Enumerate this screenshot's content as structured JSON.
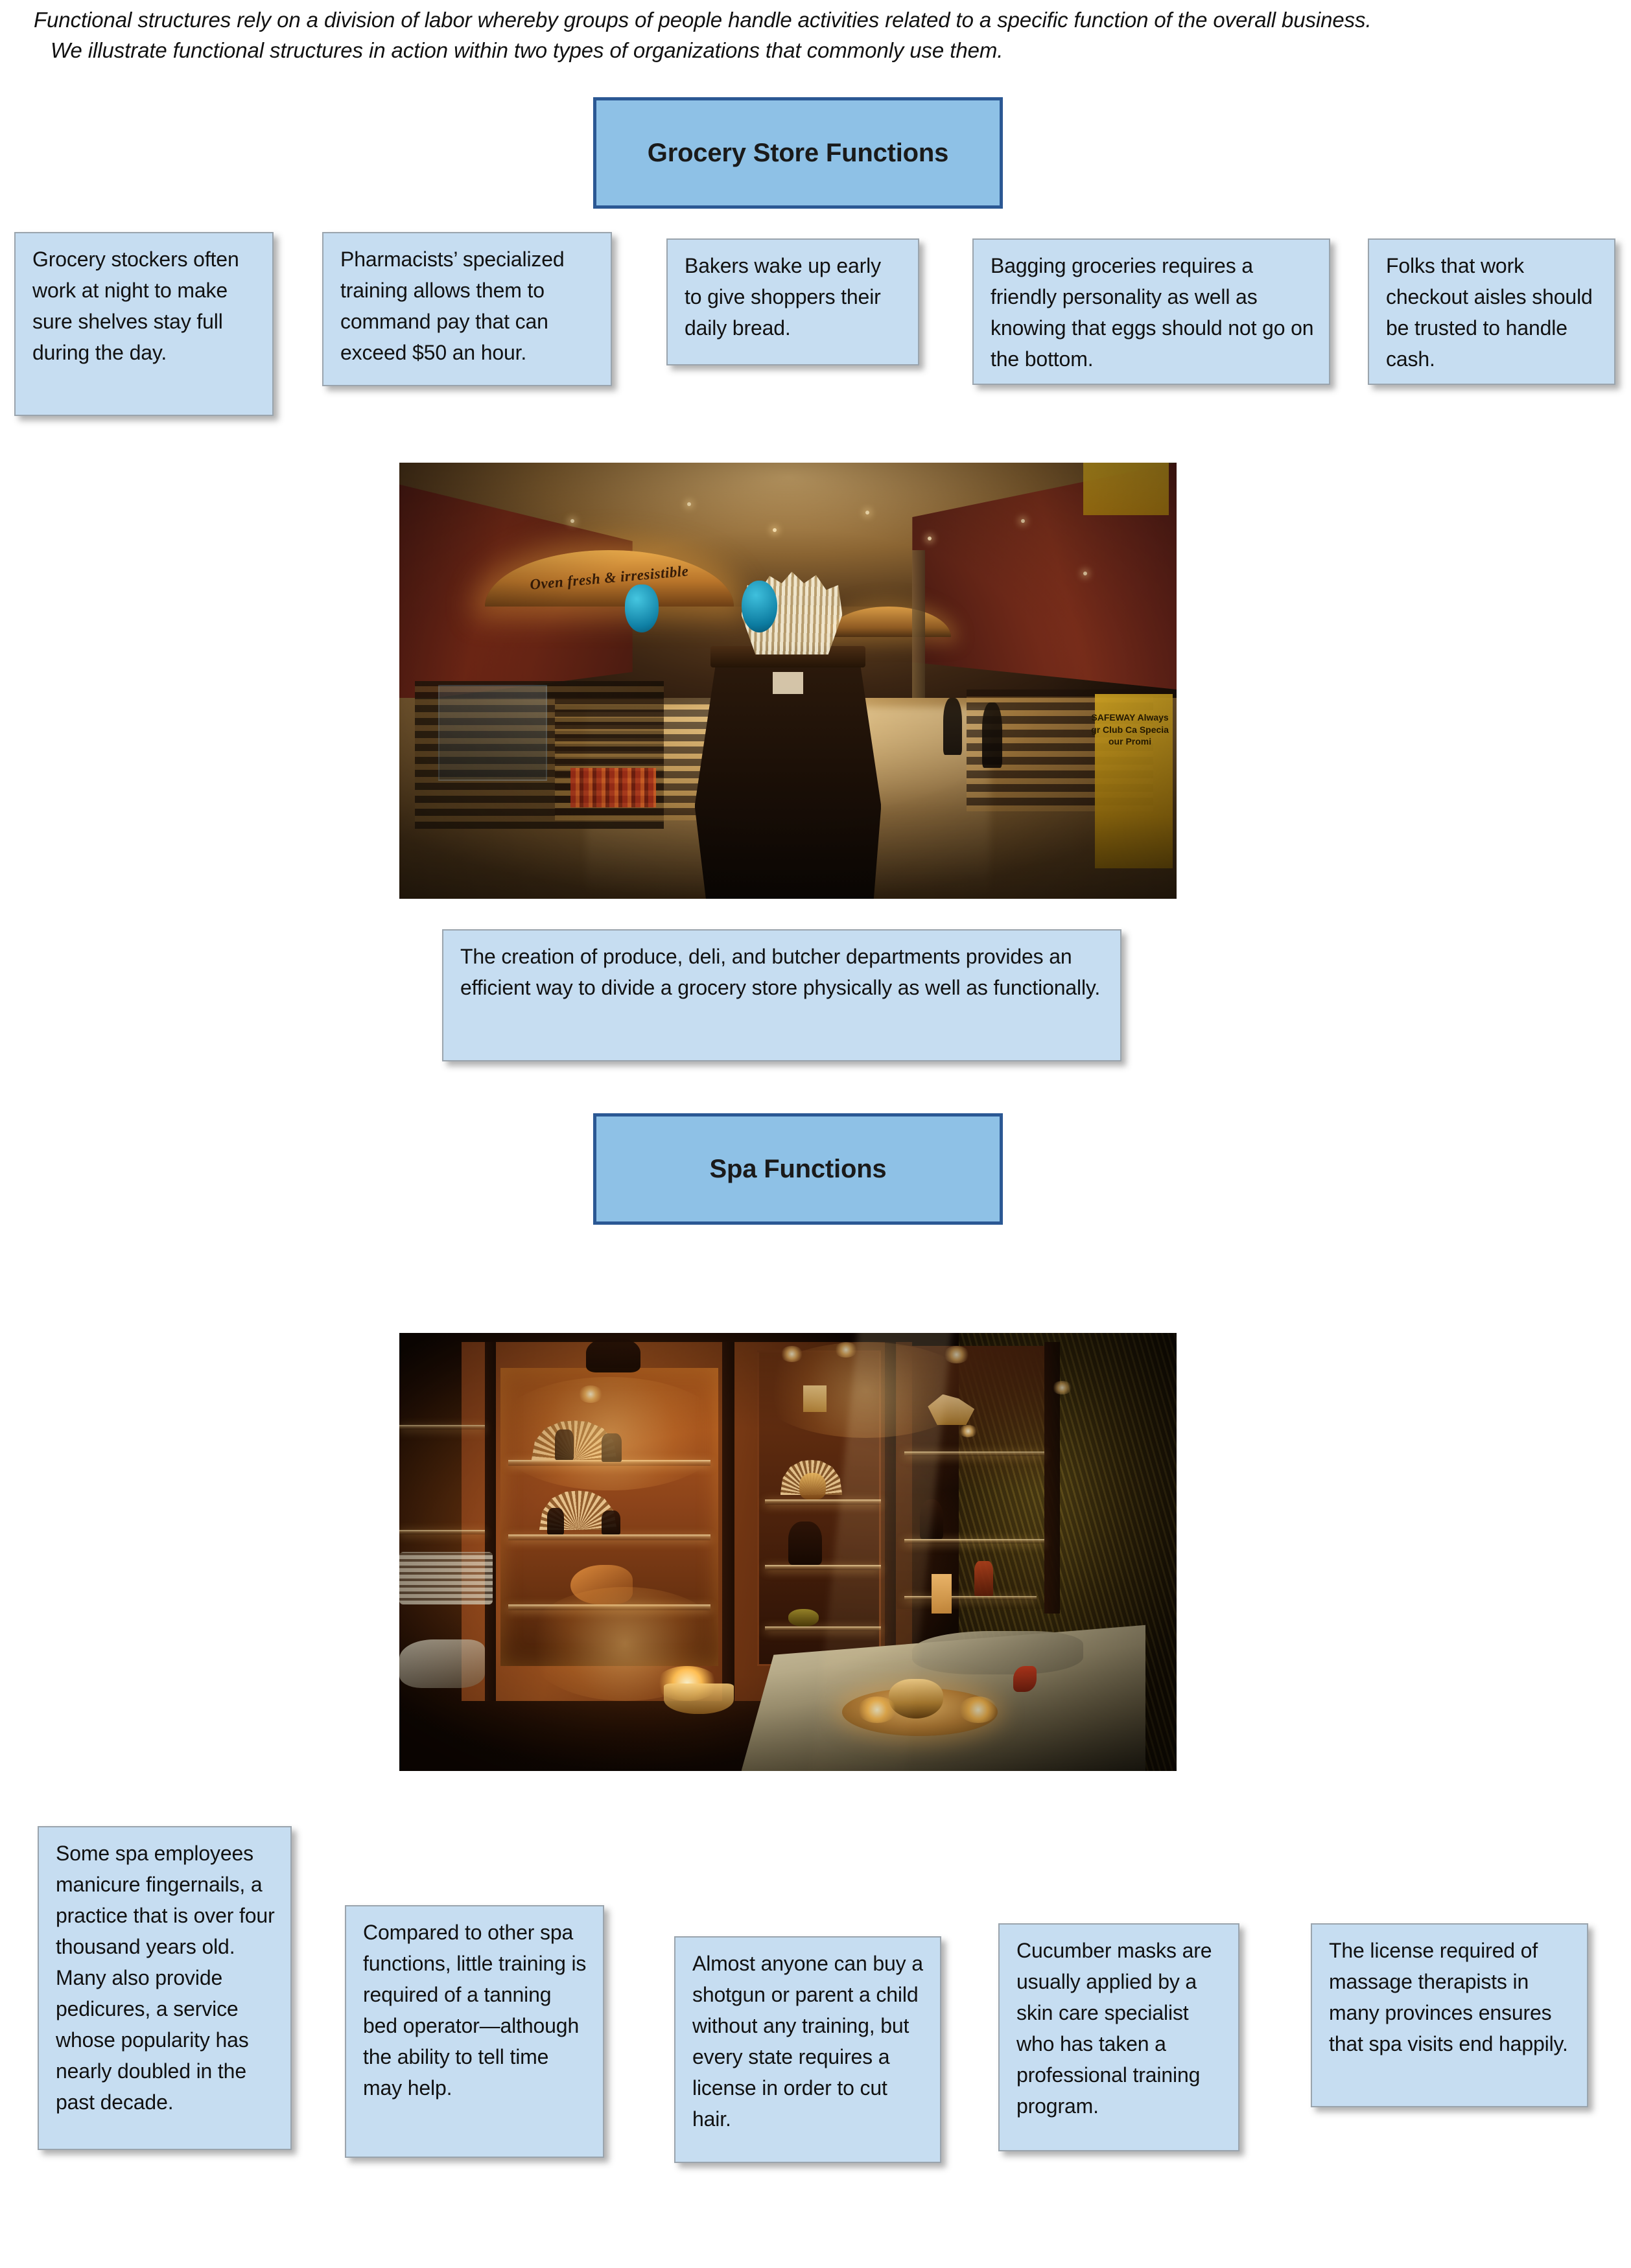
{
  "intro": {
    "line1": "Functional structures rely on a division of labor whereby groups of people handle activities related to a specific function of the overall business.",
    "line2": "We illustrate functional structures in action within two types of organizations that commonly use them."
  },
  "colors": {
    "header_fill": "#8EC1E6",
    "header_border": "#2B5894",
    "callout_fill": "#C6DDF1",
    "callout_border": "#9AA4AD",
    "text": "#111111",
    "page_background": "#FFFFFF"
  },
  "sections": [
    {
      "id": "grocery",
      "header": "Grocery Store Functions",
      "callouts": [
        "Grocery stockers often work at night to make sure shelves stay full during the day.",
        "Pharmacists’ specialized training allows them to command pay that can exceed $50 an hour.",
        "Bakers wake up early to give shoppers their daily bread.",
        "Bagging groceries requires a friendly personality as well as knowing that eggs should not go on the bottom.",
        "Folks that work checkout aisles should be trusted to handle cash."
      ],
      "photo_alt": "grocery-store-interior-photo",
      "photo_sign_arch": "Oven fresh & irresistible",
      "photo_sign_right": "SAFEWAY Always gr Club Ca Specia our Promi",
      "caption": "The creation of produce, deli, and butcher departments provides an efficient way to divide a grocery store physically as well as functionally."
    },
    {
      "id": "spa",
      "header": "Spa Functions",
      "photo_alt": "spa-treatment-room-photo",
      "callouts": [
        "Some spa employees manicure fingernails, a practice that is over four thousand years old. Many also provide pedicures, a service whose popularity has nearly doubled in the past decade.",
        "Compared to other spa functions, little training is required of a tanning bed operator—although the ability to tell time may help.",
        "Almost anyone can buy a shotgun or parent a child without any training, but every state requires a license in order to cut hair.",
        "Cucumber masks are usually applied by a skin care specialist who has taken a professional training program.",
        "The license required of massage therapists in many provinces ensures that spa visits end happily."
      ]
    }
  ]
}
